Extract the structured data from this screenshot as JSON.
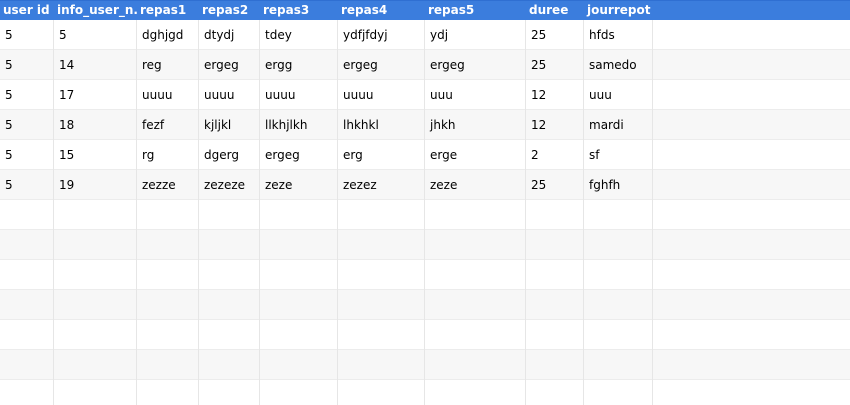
{
  "table": {
    "columns": [
      "user id",
      "info_user_n...",
      "repas1",
      "repas2",
      "repas3",
      "repas4",
      "repas5",
      "duree",
      "jourrepot",
      ""
    ],
    "rows": [
      [
        "5",
        "5",
        "dghjgd",
        "dtydj",
        "tdey",
        "ydfjfdyj",
        "ydj",
        "25",
        "hfds",
        ""
      ],
      [
        "5",
        "14",
        "reg",
        "ergeg",
        "ergg",
        "ergeg",
        "ergeg",
        "25",
        "samedo",
        ""
      ],
      [
        "5",
        "17",
        "uuuu",
        "uuuu",
        "uuuu",
        "uuuu",
        "uuu",
        "12",
        "uuu",
        ""
      ],
      [
        "5",
        "18",
        "fezf",
        "kjljkl",
        "llkhjlkh",
        "lhkhkl",
        "jhkh",
        "12",
        "mardi",
        ""
      ],
      [
        "5",
        "15",
        "rg",
        "dgerg",
        "ergeg",
        "erg",
        "erge",
        "2",
        "sf",
        ""
      ],
      [
        "5",
        "19",
        "zezze",
        "zezeze",
        "zeze",
        "zezez",
        "zeze",
        "25",
        "fghfh",
        ""
      ],
      [
        "",
        "",
        "",
        "",
        "",
        "",
        "",
        "",
        "",
        ""
      ],
      [
        "",
        "",
        "",
        "",
        "",
        "",
        "",
        "",
        "",
        ""
      ],
      [
        "",
        "",
        "",
        "",
        "",
        "",
        "",
        "",
        "",
        ""
      ],
      [
        "",
        "",
        "",
        "",
        "",
        "",
        "",
        "",
        "",
        ""
      ],
      [
        "",
        "",
        "",
        "",
        "",
        "",
        "",
        "",
        "",
        ""
      ],
      [
        "",
        "",
        "",
        "",
        "",
        "",
        "",
        "",
        "",
        ""
      ],
      [
        "",
        "",
        "",
        "",
        "",
        "",
        "",
        "",
        "",
        ""
      ]
    ]
  },
  "colors": {
    "header_bg": "#3b7ddd",
    "header_text": "#ffffff",
    "row_alt_bg": "#f7f7f7",
    "grid_line": "#e6e6e6"
  }
}
